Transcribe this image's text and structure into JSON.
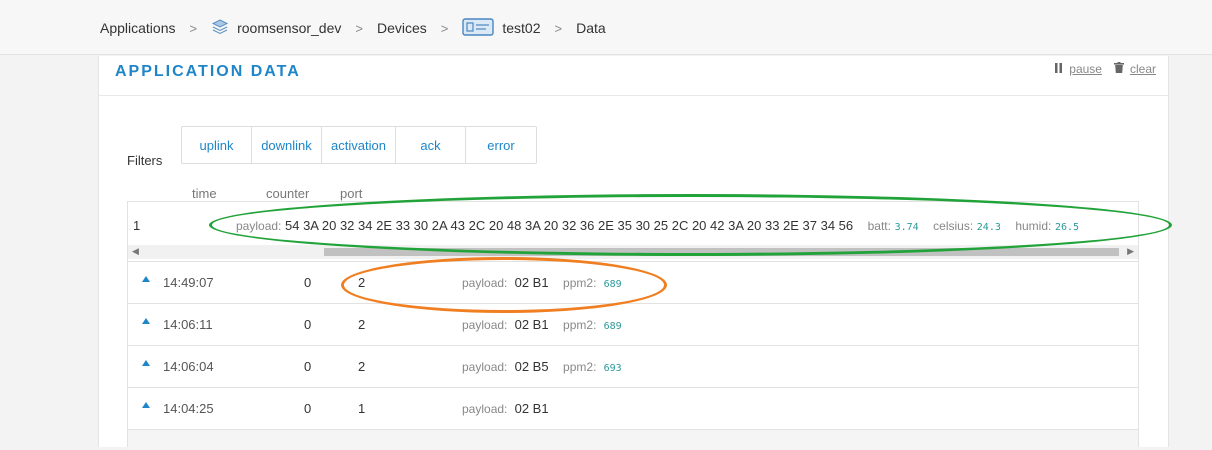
{
  "breadcrumb": {
    "applications": "Applications",
    "app": "roomsensor_dev",
    "devices": "Devices",
    "device": "test02",
    "data": "Data",
    "separator": ">"
  },
  "panel": {
    "title": "APPLICATION DATA",
    "pause_label": "pause",
    "clear_label": "clear"
  },
  "filters": {
    "label": "Filters",
    "buttons": [
      "uplink",
      "downlink",
      "activation",
      "ack",
      "error"
    ]
  },
  "columns": {
    "time": "time",
    "counter": "counter",
    "port": "port"
  },
  "expanded_row": {
    "index": "1",
    "payload_label": "payload:",
    "payload": "54 3A 20 32 34 2E 33 30 2A 43 2C 20 48 3A 20 32 36 2E 35 30 25 2C 20 42 3A 20 33 2E 37 34 56",
    "batt_label": "batt:",
    "batt": "3.74",
    "celsius_label": "celsius:",
    "celsius": "24.3",
    "humid_label": "humid:",
    "humid": "26.5"
  },
  "rows": [
    {
      "time": "14:49:07",
      "counter": "0",
      "port": "2",
      "payload_label": "payload:",
      "payload": "02 B1",
      "ppm2_label": "ppm2:",
      "ppm2": "689"
    },
    {
      "time": "14:06:11",
      "counter": "0",
      "port": "2",
      "payload_label": "payload:",
      "payload": "02 B1",
      "ppm2_label": "ppm2:",
      "ppm2": "689"
    },
    {
      "time": "14:06:04",
      "counter": "0",
      "port": "2",
      "payload_label": "payload:",
      "payload": "02 B5",
      "ppm2_label": "ppm2:",
      "ppm2": "693"
    },
    {
      "time": "14:04:25",
      "counter": "0",
      "port": "1",
      "payload_label": "payload:",
      "payload": "02 B1",
      "ppm2_label": "",
      "ppm2": ""
    }
  ],
  "colors": {
    "accent": "#1e86c8",
    "highlight_green": "#22a33a",
    "highlight_orange": "#f07f22"
  }
}
